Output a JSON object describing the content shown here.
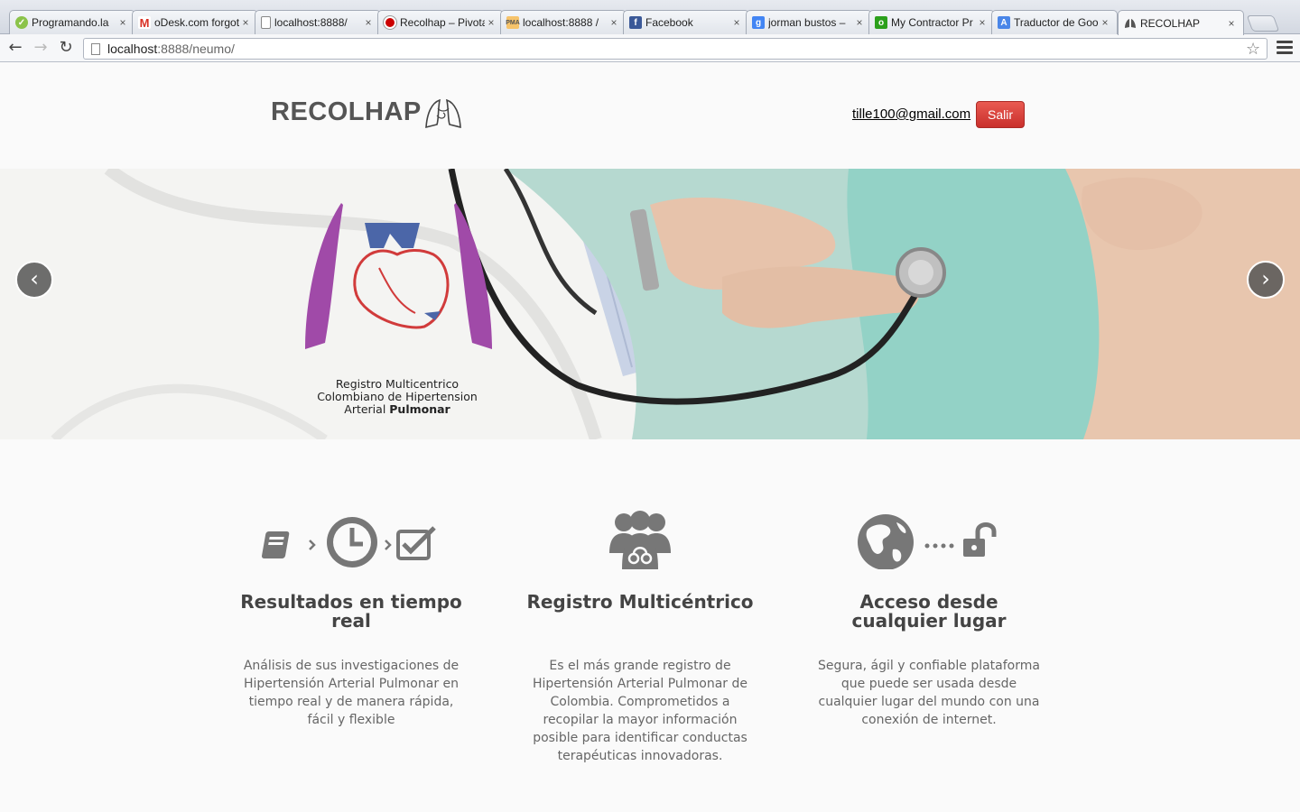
{
  "browser": {
    "tabs": [
      {
        "title": "Programando.la",
        "icon": "programando-favicon-icon",
        "color": "#8bc34a"
      },
      {
        "title": "oDesk.com forgot",
        "icon": "gmail-favicon-icon",
        "color": "#d93025"
      },
      {
        "title": "localhost:8888/",
        "icon": "page-favicon-icon",
        "color": "#ffffff"
      },
      {
        "title": "Recolhap – Pivotal",
        "icon": "pivotal-favicon-icon",
        "color": "#cc0000"
      },
      {
        "title": "localhost:8888 /",
        "icon": "phpmyadmin-favicon-icon",
        "color": "#f0a030"
      },
      {
        "title": "Facebook",
        "icon": "facebook-favicon-icon",
        "color": "#3b5998"
      },
      {
        "title": "jorman bustos –",
        "icon": "google-favicon-icon",
        "color": "#4285f4"
      },
      {
        "title": "My Contractor Pr",
        "icon": "odesk-favicon-icon",
        "color": "#2ca01c"
      },
      {
        "title": "Traductor de Goo",
        "icon": "translate-favicon-icon",
        "color": "#4a86e8"
      },
      {
        "title": "RECOLHAP",
        "icon": "lungs-favicon-icon",
        "color": "#555555"
      }
    ],
    "url_host": "localhost",
    "url_path": ":8888/neumo/",
    "back": "←",
    "forward": "→",
    "reload": "↻",
    "star": "☆",
    "close": "×"
  },
  "header": {
    "brand": "RECOLHAP",
    "email": "tille100@gmail.com",
    "logout": "Salir"
  },
  "carousel": {
    "caption_line1": "Registro Multicentrico",
    "caption_line2": "Colombiano de Hipertension",
    "caption_line3_a": "Arterial ",
    "caption_line3_b": "Pulmonar",
    "prev": "‹",
    "next": "›"
  },
  "features": [
    {
      "title": "Resultados en tiempo real",
      "text": "Análisis de sus investigaciones de Hipertensión Arterial Pulmonar en tiempo real y de manera rápida, fácil y flexible"
    },
    {
      "title": "Registro Multicéntrico",
      "text": "Es el más grande registro de Hipertensión Arterial Pulmonar de Colombia. Comprometidos a recopilar la mayor información posible para identificar conductas terapéuticas innovadoras."
    },
    {
      "title": "Acceso desde cualquier lugar",
      "text": "Segura, ágil y confiable plataforma que puede ser usada desde cualquier lugar del mundo con una conexión de internet."
    }
  ]
}
